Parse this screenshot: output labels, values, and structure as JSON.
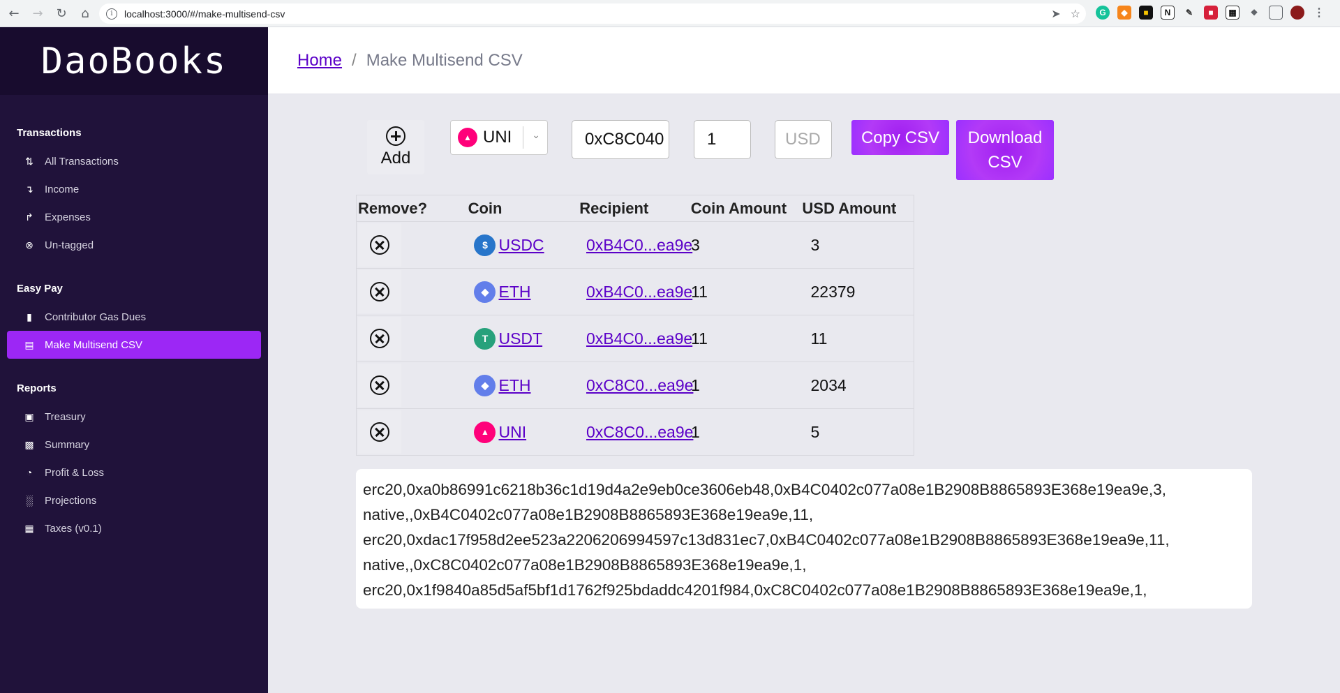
{
  "browser": {
    "url": "localhost:3000/#/make-multisend-csv"
  },
  "sidebar": {
    "logo": "DaoBooks",
    "sections": [
      {
        "title": "Transactions",
        "items": [
          {
            "label": "All Transactions",
            "icon": "arrows-updown-icon"
          },
          {
            "label": "Income",
            "icon": "arrow-down-icon"
          },
          {
            "label": "Expenses",
            "icon": "arrow-up-icon"
          },
          {
            "label": "Un-tagged",
            "icon": "x-circle-icon"
          }
        ]
      },
      {
        "title": "Easy Pay",
        "items": [
          {
            "label": "Contributor Gas Dues",
            "icon": "gas-icon"
          },
          {
            "label": "Make Multisend CSV",
            "icon": "csv-icon",
            "active": true
          }
        ]
      },
      {
        "title": "Reports",
        "items": [
          {
            "label": "Treasury",
            "icon": "safe-icon"
          },
          {
            "label": "Summary",
            "icon": "document-icon"
          },
          {
            "label": "Profit & Loss",
            "icon": "profit-loss-icon"
          },
          {
            "label": "Projections",
            "icon": "bar-chart-icon"
          },
          {
            "label": "Taxes (v0.1)",
            "icon": "bank-icon"
          }
        ]
      }
    ]
  },
  "header": {
    "home": "Home",
    "separator": "/",
    "current": "Make Multisend CSV"
  },
  "toolbar": {
    "add_label": "Add",
    "coin_selected": "UNI",
    "recipient_value": "0xC8C040",
    "amount_value": "1",
    "usd_placeholder": "USD",
    "copy_label": "Copy CSV",
    "download_label": "Download CSV"
  },
  "table": {
    "headers": [
      "Remove?",
      "Coin",
      "Recipient",
      "Coin Amount",
      "USD Amount"
    ],
    "rows": [
      {
        "coin": "USDC",
        "recipient": "0xB4C0...ea9e",
        "amount": "3",
        "usd": "3"
      },
      {
        "coin": "ETH",
        "recipient": "0xB4C0...ea9e",
        "amount": "11",
        "usd": "22379"
      },
      {
        "coin": "USDT",
        "recipient": "0xB4C0...ea9e",
        "amount": "11",
        "usd": "11"
      },
      {
        "coin": "ETH",
        "recipient": "0xC8C0...ea9e",
        "amount": "1",
        "usd": "2034"
      },
      {
        "coin": "UNI",
        "recipient": "0xC8C0...ea9e",
        "amount": "1",
        "usd": "5"
      }
    ]
  },
  "csv_lines": [
    "erc20,0xa0b86991c6218b36c1d19d4a2e9eb0ce3606eb48,0xB4C0402c077a08e1B2908B8865893E368e19ea9e,3,",
    "native,,0xB4C0402c077a08e1B2908B8865893E368e19ea9e,11,",
    "erc20,0xdac17f958d2ee523a2206206994597c13d831ec7,0xB4C0402c077a08e1B2908B8865893E368e19ea9e,11,",
    "native,,0xC8C0402c077a08e1B2908B8865893E368e19ea9e,1,",
    "erc20,0x1f9840a85d5af5bf1d1762f925bdaddc4201f984,0xC8C0402c077a08e1B2908B8865893E368e19ea9e,1,"
  ],
  "colors": {
    "sidebar_bg": "#20123a",
    "accent": "#9c27f5",
    "link": "#5b00c8",
    "usdc": "#2775ca",
    "eth": "#627eea",
    "usdt": "#26a17b",
    "uni": "#ff007a"
  }
}
